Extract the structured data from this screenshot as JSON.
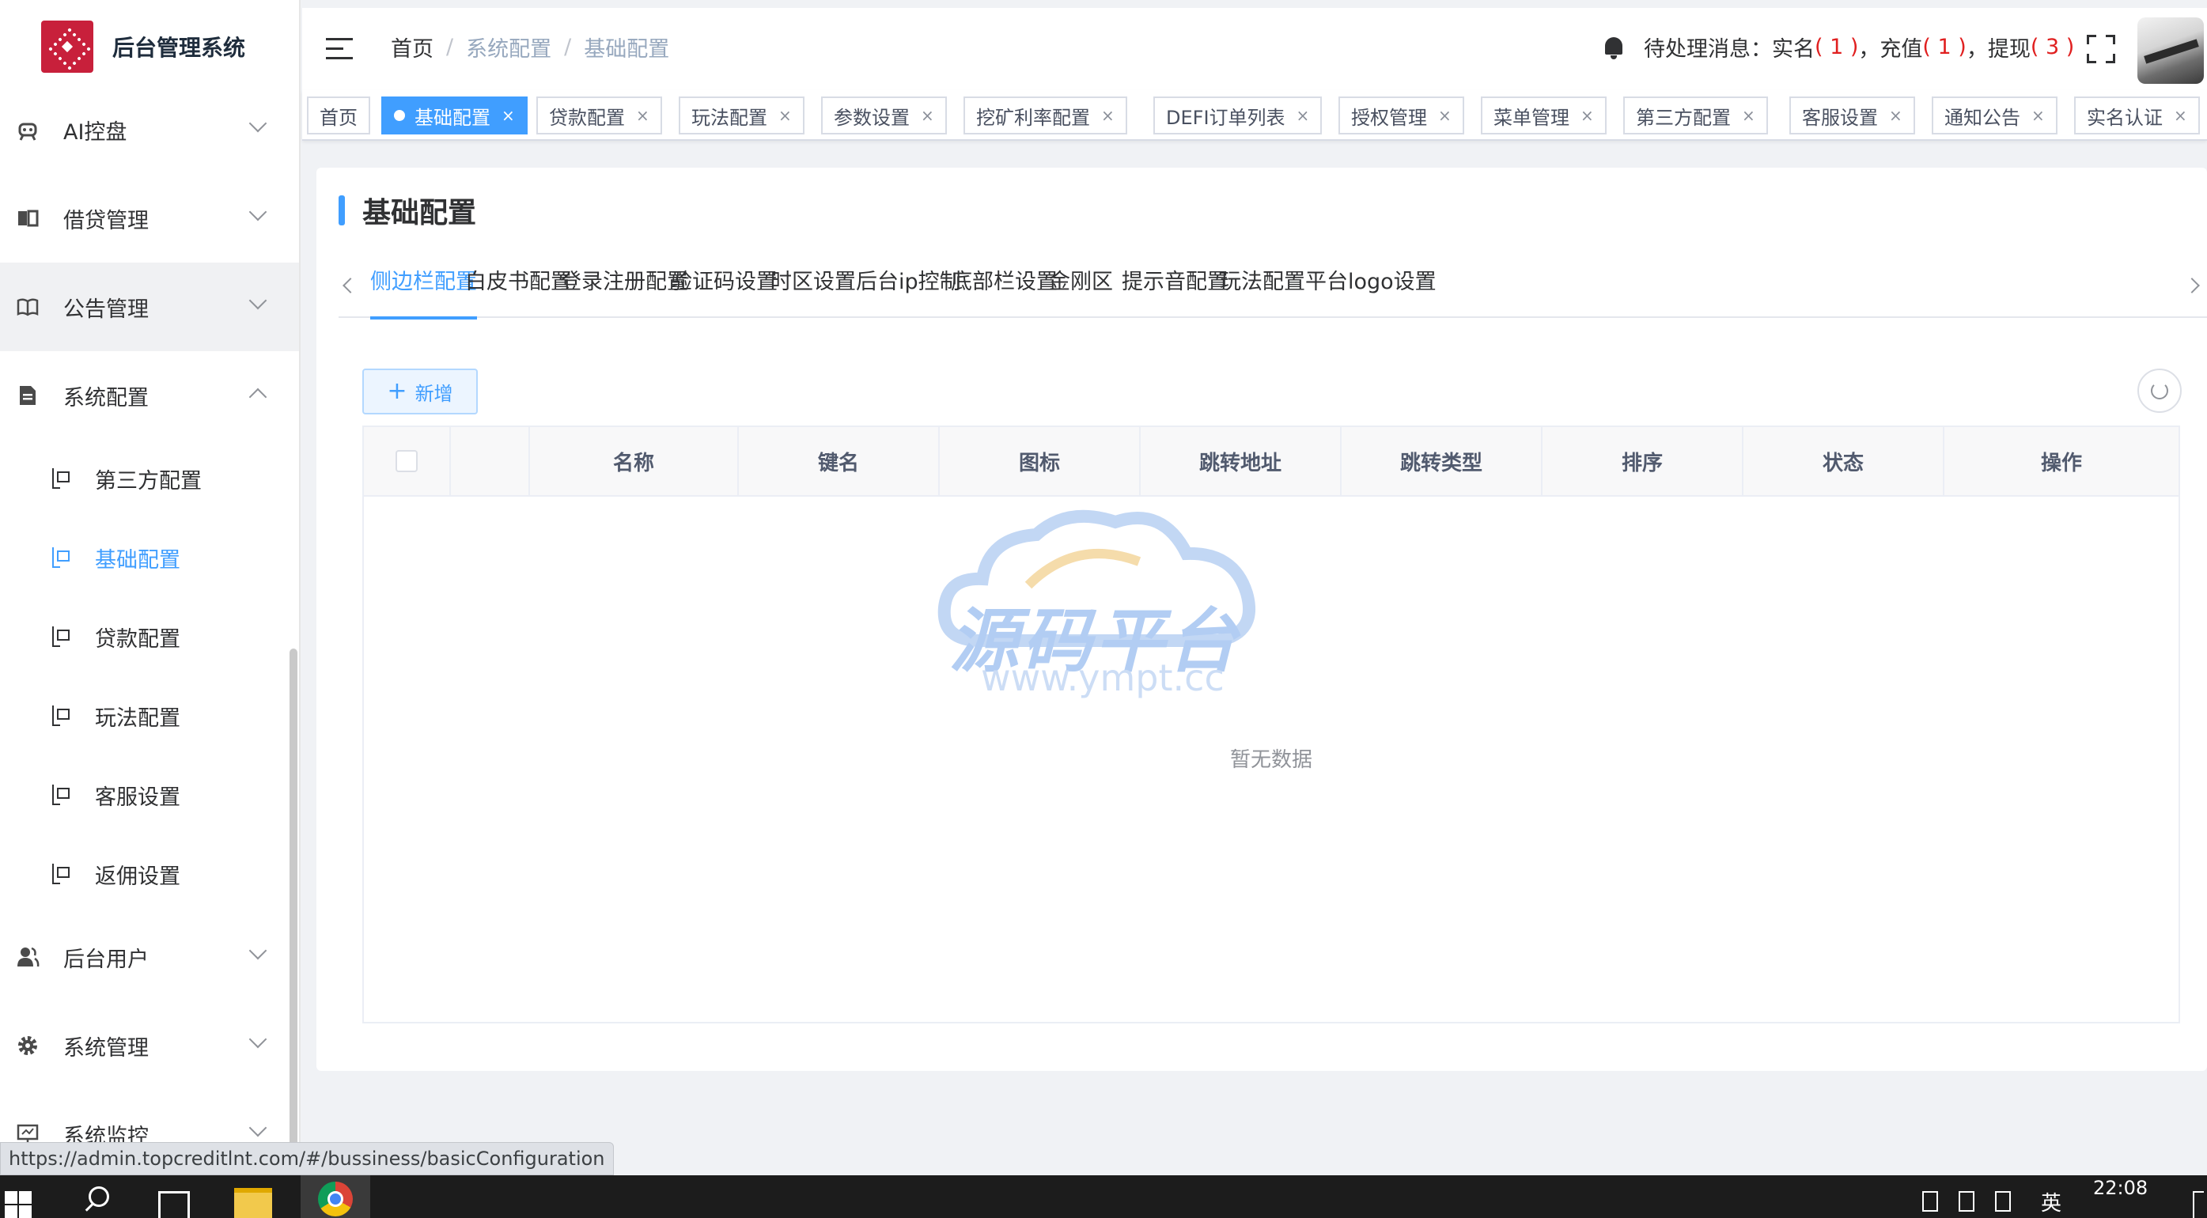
{
  "app": {
    "title": "后台管理系统"
  },
  "sidebar": {
    "menus": [
      {
        "label": "AI控盘",
        "icon": "robot-icon",
        "expanded": false
      },
      {
        "label": "借贷管理",
        "icon": "book-open-icon",
        "expanded": false
      },
      {
        "label": "公告管理",
        "icon": "book-icon",
        "expanded": false
      },
      {
        "label": "系统配置",
        "icon": "document-icon",
        "expanded": true
      },
      {
        "label": "后台用户",
        "icon": "users-icon",
        "expanded": false
      },
      {
        "label": "系统管理",
        "icon": "gear-icon",
        "expanded": false
      },
      {
        "label": "系统监控",
        "icon": "monitor-icon",
        "expanded": false
      }
    ],
    "sub_items": [
      {
        "label": "第三方配置",
        "active": false
      },
      {
        "label": "基础配置",
        "active": true
      },
      {
        "label": "贷款配置",
        "active": false
      },
      {
        "label": "玩法配置",
        "active": false
      },
      {
        "label": "客服设置",
        "active": false
      },
      {
        "label": "返佣设置",
        "active": false
      }
    ]
  },
  "header": {
    "breadcrumb": [
      "首页",
      "系统配置",
      "基础配置"
    ],
    "notice": {
      "prefix": "待处理消息：实名",
      "real_name_count": "( 1 )",
      "recharge_label": "，充值",
      "recharge_count": "( 1 )",
      "withdraw_label": "，提现",
      "withdraw_count": "( 3 )"
    }
  },
  "tags": [
    {
      "label": "首页",
      "active": false,
      "closable": false
    },
    {
      "label": "基础配置",
      "active": true,
      "closable": true
    },
    {
      "label": "贷款配置",
      "active": false,
      "closable": true
    },
    {
      "label": "玩法配置",
      "active": false,
      "closable": true
    },
    {
      "label": "参数设置",
      "active": false,
      "closable": true
    },
    {
      "label": "挖矿利率配置",
      "active": false,
      "closable": true
    },
    {
      "label": "DEFI订单列表",
      "active": false,
      "closable": true
    },
    {
      "label": "授权管理",
      "active": false,
      "closable": true
    },
    {
      "label": "菜单管理",
      "active": false,
      "closable": true
    },
    {
      "label": "第三方配置",
      "active": false,
      "closable": true
    },
    {
      "label": "客服设置",
      "active": false,
      "closable": true
    },
    {
      "label": "通知公告",
      "active": false,
      "closable": true
    },
    {
      "label": "实名认证",
      "active": false,
      "closable": true
    }
  ],
  "tag_close": "×",
  "main": {
    "title": "基础配置",
    "tabs": [
      "侧边栏配置",
      "白皮书配置",
      "登录注册配置",
      "验证码设置",
      "时区设置",
      "后台ip控制",
      "底部栏设置",
      "金刚区",
      "提示音配置",
      "玩法配置",
      "平台logo设置"
    ],
    "active_tab": 0,
    "add_button": "新增",
    "add_plus": "+",
    "table": {
      "columns": [
        "名称",
        "键名",
        "图标",
        "跳转地址",
        "跳转类型",
        "排序",
        "状态",
        "操作"
      ],
      "rows": [],
      "empty_text": "暂无数据"
    }
  },
  "watermark": {
    "text": "源码平台",
    "url": "www.ympt.cc"
  },
  "browser_status_url": "https://admin.topcreditlnt.com/#/bussiness/basicConfiguration",
  "taskbar": {
    "ime": "英",
    "time": "22:08"
  },
  "colors": {
    "primary": "#409eff",
    "danger": "#e02020",
    "logo": "#c8203b"
  }
}
